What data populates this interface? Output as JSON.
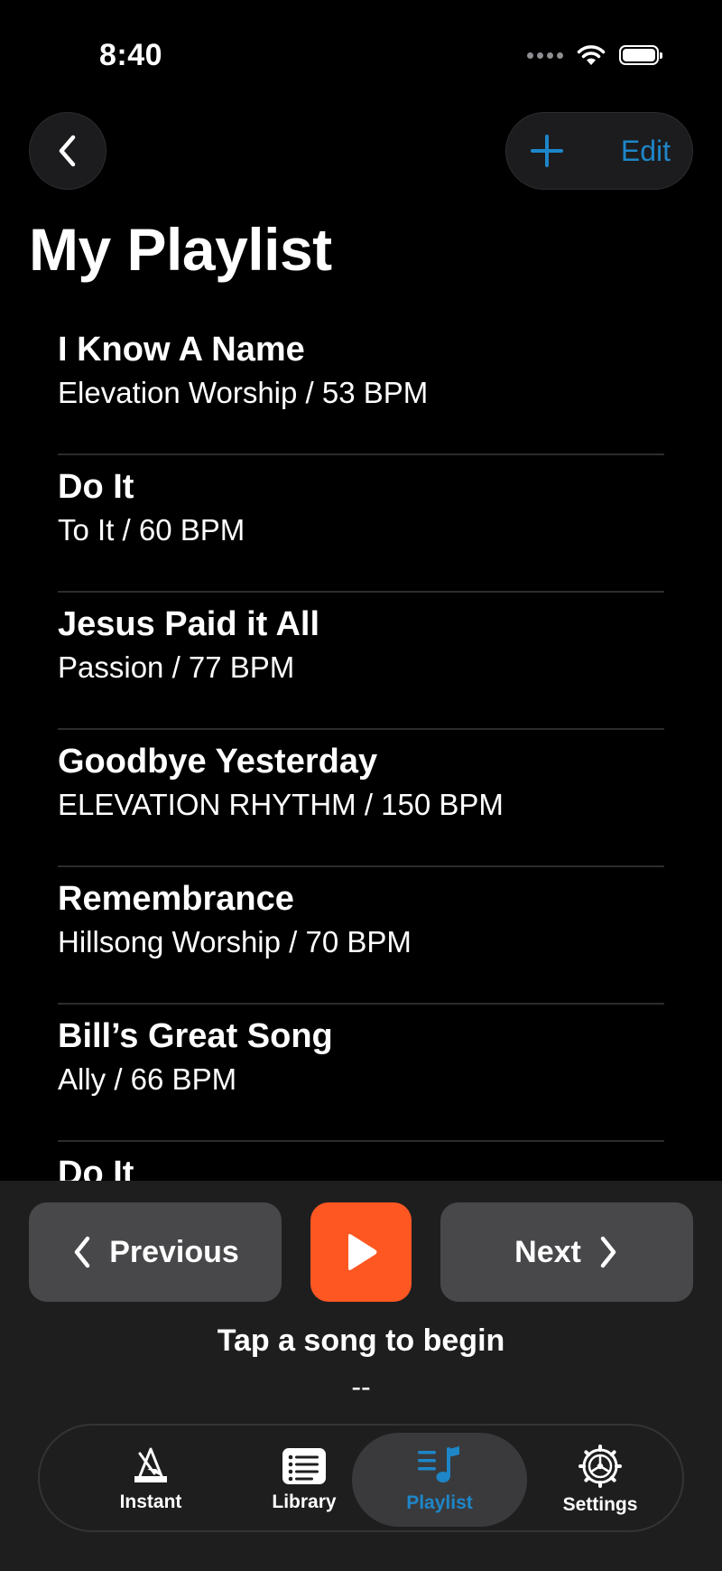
{
  "status_bar": {
    "time": "8:40"
  },
  "header": {
    "title": "My Playlist",
    "edit_label": "Edit"
  },
  "songs": [
    {
      "title": "I Know A Name",
      "meta": "Elevation Worship /  53 BPM"
    },
    {
      "title": "Do It",
      "meta": "To It /  60 BPM"
    },
    {
      "title": "Jesus Paid it All",
      "meta": "Passion /  77 BPM"
    },
    {
      "title": "Goodbye Yesterday",
      "meta": "ELEVATION RHYTHM /  150 BPM"
    },
    {
      "title": "Remembrance",
      "meta": "Hillsong Worship /  70 BPM"
    },
    {
      "title": "Bill’s Great Song",
      "meta": "Ally /  66 BPM"
    },
    {
      "title": "Do It",
      "meta": ""
    }
  ],
  "player": {
    "previous_label": "Previous",
    "next_label": "Next",
    "status_text": "Tap a song to begin",
    "bpm_text": "--"
  },
  "tab_bar": {
    "tabs": [
      {
        "label": "Instant",
        "icon": "metronome-icon"
      },
      {
        "label": "Library",
        "icon": "list-icon"
      },
      {
        "label": "Playlist",
        "icon": "music-list-icon",
        "active": true
      },
      {
        "label": "Settings",
        "icon": "gear-icon"
      }
    ]
  },
  "colors": {
    "accent": "#1e86c8",
    "play": "#ff5722",
    "background": "#000000"
  }
}
